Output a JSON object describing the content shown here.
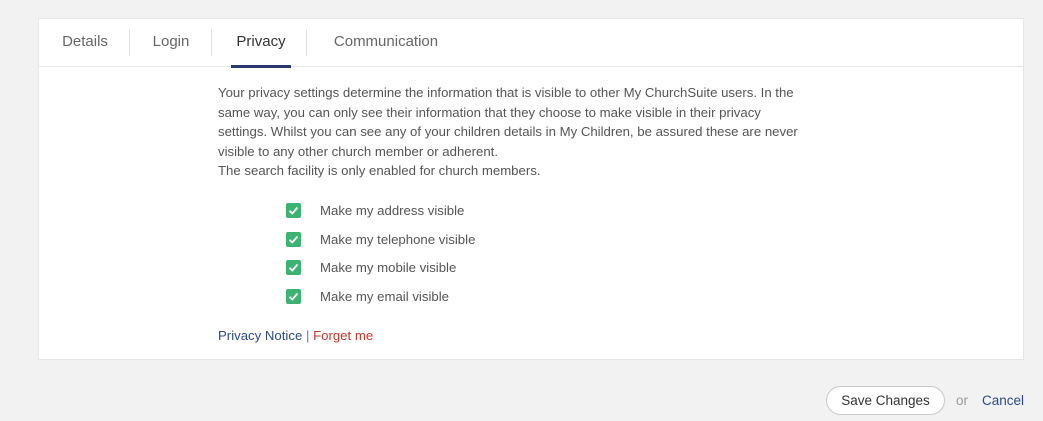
{
  "tabs": [
    {
      "label": "Details",
      "active": false
    },
    {
      "label": "Login",
      "active": false
    },
    {
      "label": "Privacy",
      "active": true
    },
    {
      "label": "Communication",
      "active": false
    }
  ],
  "privacy": {
    "paragraph_lines": [
      "Your privacy settings determine the information that is visible to other My ChurchSuite users.  In the",
      "same way, you can only see their information that they choose to make visible in their privacy",
      "settings.  Whilst you can see any of your children details in My Children, be assured these are never",
      "visible to any other church member or adherent.",
      "The search facility is only enabled for church members."
    ],
    "options": [
      {
        "label": "Make my address visible",
        "checked": true
      },
      {
        "label": "Make my telephone visible",
        "checked": true
      },
      {
        "label": "Make my mobile visible",
        "checked": true
      },
      {
        "label": "Make my email visible",
        "checked": true
      }
    ],
    "privacy_notice": "Privacy Notice",
    "separator": "|",
    "forget_me": "Forget me"
  },
  "footer": {
    "save_label": "Save Changes",
    "or_text": "or",
    "cancel_label": "Cancel"
  },
  "colors": {
    "checkbox": "#3cb371",
    "active_tab_underline": "#2a3a6e",
    "link_blue": "#2a4a8a",
    "link_red": "#c0392b"
  }
}
